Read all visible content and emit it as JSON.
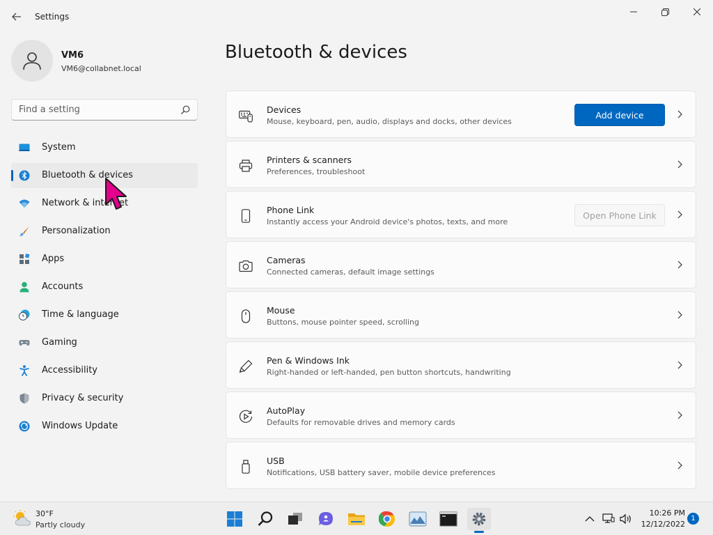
{
  "window": {
    "title": "Settings",
    "back_icon": "arrow-left-icon",
    "controls": [
      "minimize-icon",
      "restore-icon",
      "close-icon"
    ]
  },
  "profile": {
    "name": "VM6",
    "email": "VM6@collabnet.local",
    "avatar_icon": "person-icon"
  },
  "search": {
    "placeholder": "Find a setting",
    "value": "",
    "icon": "search-icon"
  },
  "nav": {
    "active_index": 1,
    "items": [
      {
        "label": "System",
        "icon": "monitor-icon"
      },
      {
        "label": "Bluetooth & devices",
        "icon": "bluetooth-icon"
      },
      {
        "label": "Network & internet",
        "icon": "wifi-icon"
      },
      {
        "label": "Personalization",
        "icon": "brush-icon"
      },
      {
        "label": "Apps",
        "icon": "apps-icon"
      },
      {
        "label": "Accounts",
        "icon": "account-icon"
      },
      {
        "label": "Time & language",
        "icon": "clock-globe-icon"
      },
      {
        "label": "Gaming",
        "icon": "gamepad-icon"
      },
      {
        "label": "Accessibility",
        "icon": "accessibility-icon"
      },
      {
        "label": "Privacy & security",
        "icon": "shield-icon"
      },
      {
        "label": "Windows Update",
        "icon": "update-icon"
      }
    ]
  },
  "main": {
    "title": "Bluetooth & devices",
    "cards": [
      {
        "title": "Devices",
        "subtitle": "Mouse, keyboard, pen, audio, displays and docks, other devices",
        "icon": "devices-icon",
        "button": "Add device",
        "button_state": "primary"
      },
      {
        "title": "Printers & scanners",
        "subtitle": "Preferences, troubleshoot",
        "icon": "printer-icon"
      },
      {
        "title": "Phone Link",
        "subtitle": "Instantly access your Android device's photos, texts, and more",
        "icon": "phone-icon",
        "button": "Open Phone Link",
        "button_state": "disabled"
      },
      {
        "title": "Cameras",
        "subtitle": "Connected cameras, default image settings",
        "icon": "camera-icon"
      },
      {
        "title": "Mouse",
        "subtitle": "Buttons, mouse pointer speed, scrolling",
        "icon": "mouse-icon"
      },
      {
        "title": "Pen & Windows Ink",
        "subtitle": "Right-handed or left-handed, pen button shortcuts, handwriting",
        "icon": "pen-icon"
      },
      {
        "title": "AutoPlay",
        "subtitle": "Defaults for removable drives and memory cards",
        "icon": "autoplay-icon"
      },
      {
        "title": "USB",
        "subtitle": "Notifications, USB battery saver, mobile device preferences",
        "icon": "usb-icon"
      }
    ]
  },
  "taskbar": {
    "weather": {
      "temp": "30°F",
      "desc": "Partly cloudy",
      "icon": "partly-cloudy-icon"
    },
    "apps": [
      "windows-start-icon",
      "search-icon",
      "task-view-icon",
      "chat-icon",
      "file-explorer-icon",
      "chrome-icon",
      "photos-icon",
      "terminal-icon",
      "settings-gear-icon"
    ],
    "active_app": "settings-gear-icon",
    "tray": [
      "chevron-up-icon",
      "network-icon",
      "volume-icon"
    ],
    "clock": {
      "time": "10:26 PM",
      "date": "12/12/2022"
    },
    "notification_count": "1"
  },
  "colors": {
    "accent": "#0067c0",
    "background": "#f3f3f3",
    "card": "#fbfbfb",
    "cursor": "#e3008c"
  }
}
